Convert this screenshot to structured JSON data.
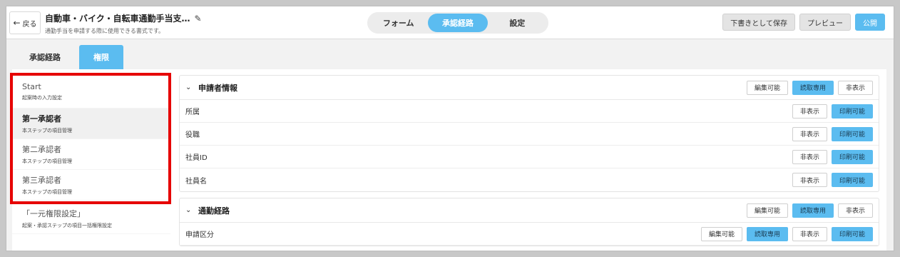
{
  "header": {
    "back_label": "戻る",
    "title": "自動車・バイク・自転車通勤手当支…",
    "subtitle": "通勤手当を申請する際に使用できる書式です。",
    "mode_tabs": [
      {
        "label": "フォーム"
      },
      {
        "label": "承認経路"
      },
      {
        "label": "設定"
      }
    ],
    "buttons": {
      "save_draft": "下書きとして保存",
      "preview": "プレビュー",
      "publish": "公開"
    }
  },
  "sub_tabs": [
    {
      "label": "承認経路"
    },
    {
      "label": "権限"
    }
  ],
  "steps": [
    {
      "name": "Start",
      "desc": "起案時の入力設定"
    },
    {
      "name": "第一承認者",
      "desc": "本ステップの項目管理"
    },
    {
      "name": "第二承認者",
      "desc": "本ステップの項目管理"
    },
    {
      "name": "第三承認者",
      "desc": "本ステップの項目管理"
    },
    {
      "name": "「一元権限設定」",
      "desc": "起案・承認ステップの項目一括権限設定"
    }
  ],
  "perm_labels": {
    "editable": "編集可能",
    "readonly": "読取専用",
    "hidden": "非表示",
    "printable": "印刷可能"
  },
  "sections": [
    {
      "title": "申請者情報",
      "rows": [
        {
          "label": "所属"
        },
        {
          "label": "役職"
        },
        {
          "label": "社員ID"
        },
        {
          "label": "社員名"
        }
      ]
    },
    {
      "title": "通勤経路",
      "rows": [
        {
          "label": "申請区分"
        }
      ]
    }
  ],
  "colors": {
    "accent": "#5bbcf0",
    "highlight_box": "#e60000"
  }
}
